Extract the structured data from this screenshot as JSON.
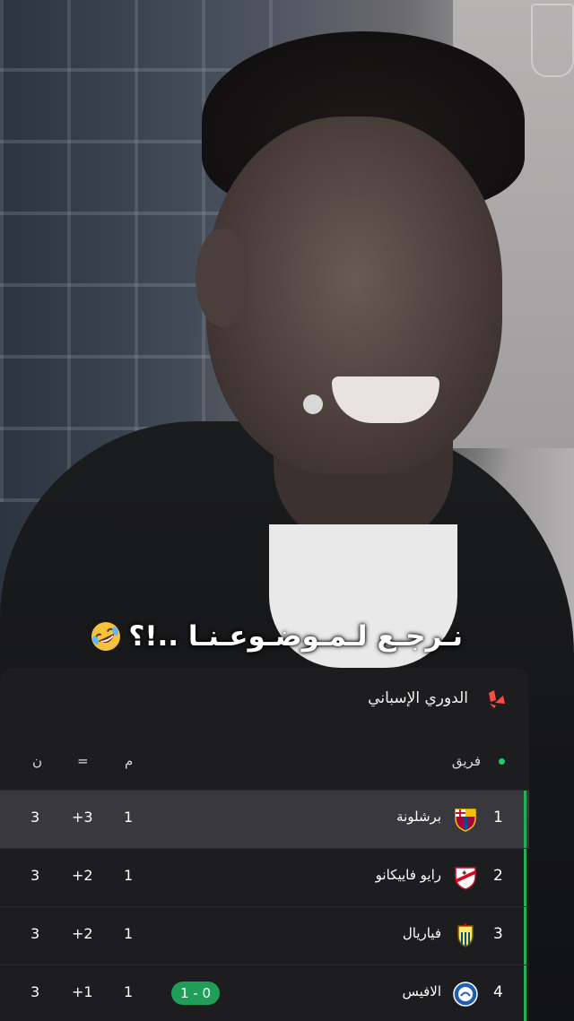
{
  "caption": {
    "text": "نـرجـع لـمـوضـوعـنـا ..!؟",
    "emoji": "rolling-on-floor-laughing"
  },
  "league": {
    "name": "الدوري الإسباني",
    "icon": "laliga-icon",
    "accent_color": "#ff4b44"
  },
  "table": {
    "headers": {
      "team": "فريق",
      "played": "م",
      "diff": "=",
      "points": "ن"
    },
    "rows": [
      {
        "rank": "1",
        "team": "برشلونة",
        "club_icon": "barcelona-crest",
        "played": "1",
        "diff": "+3",
        "points": "3",
        "form": ""
      },
      {
        "rank": "2",
        "team": "رايو فاييكانو",
        "club_icon": "rayo-crest",
        "played": "1",
        "diff": "+2",
        "points": "3",
        "form": ""
      },
      {
        "rank": "3",
        "team": "فياريال",
        "club_icon": "villarreal-crest",
        "played": "1",
        "diff": "+2",
        "points": "3",
        "form": ""
      },
      {
        "rank": "4",
        "team": "الافيس",
        "club_icon": "alaves-crest",
        "played": "1",
        "diff": "+1",
        "points": "3",
        "form": "1 - 0"
      }
    ],
    "zone_color": "#20b255"
  }
}
